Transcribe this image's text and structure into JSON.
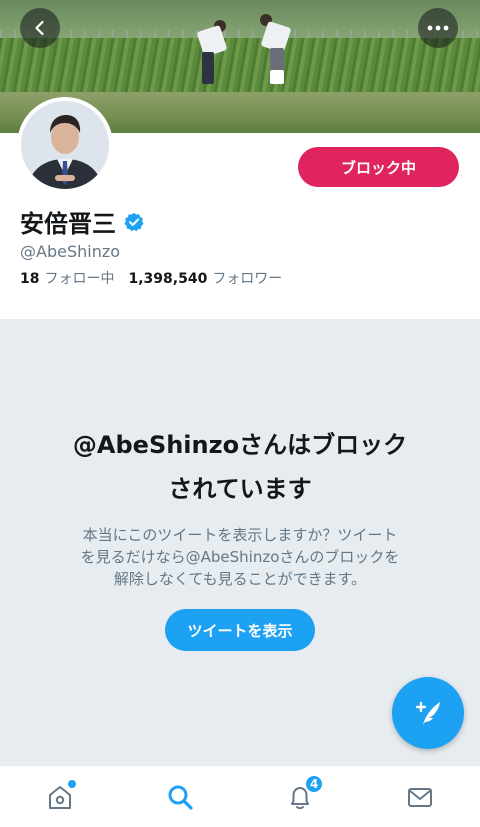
{
  "profile": {
    "name": "安倍晋三",
    "handle": "@AbeShinzo",
    "following_count": "18",
    "following_label": "フォロー中",
    "followers_count": "1,398,540",
    "followers_label": "フォロワー"
  },
  "actions": {
    "block_label": "ブロック中"
  },
  "blocked": {
    "title_line1": "@AbeShinzoさんはブロック",
    "title_line2": "されています",
    "desc_line1": "本当にこのツイートを表示しますか？ツイート",
    "desc_line2": "を見るだけなら@AbeShinzoさんのブロックを",
    "desc_line3": "解除しなくても見ることができます。",
    "show_button": "ツイートを表示"
  },
  "tabbar": {
    "notification_count": "4"
  },
  "icons": {
    "back": "chevron-left-icon",
    "more": "more-horizontal-icon",
    "verified": "verified-badge-icon",
    "compose": "compose-tweet-icon",
    "home": "home-icon",
    "search": "search-icon",
    "notifications": "bell-icon",
    "messages": "mail-icon"
  },
  "colors": {
    "accent": "#1da1f2",
    "blocked_button": "#e0245e",
    "secondary_text": "#657786",
    "blocked_background": "#e6ecf0"
  }
}
